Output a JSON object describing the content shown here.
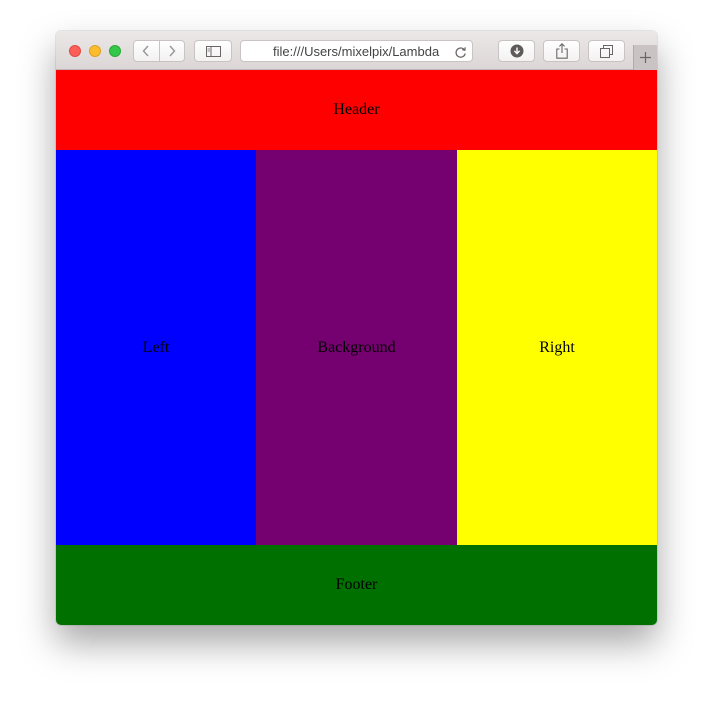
{
  "browser": {
    "address": "file:///Users/mixelpix/Lambda",
    "icons": {
      "back": "chevron-left-icon",
      "forward": "chevron-right-icon",
      "sidebar": "sidebar-icon",
      "reload": "reload-icon",
      "download": "download-icon",
      "share": "share-icon",
      "tabs": "tabs-overview-icon",
      "new_tab": "plus-icon"
    }
  },
  "page": {
    "header": "Header",
    "left": "Left",
    "center": "Background",
    "right": "Right",
    "footer": "Footer"
  },
  "colors": {
    "header": "#ff0000",
    "left": "#0000ff",
    "center": "#750070",
    "right": "#ffff00",
    "footer": "#007000"
  }
}
